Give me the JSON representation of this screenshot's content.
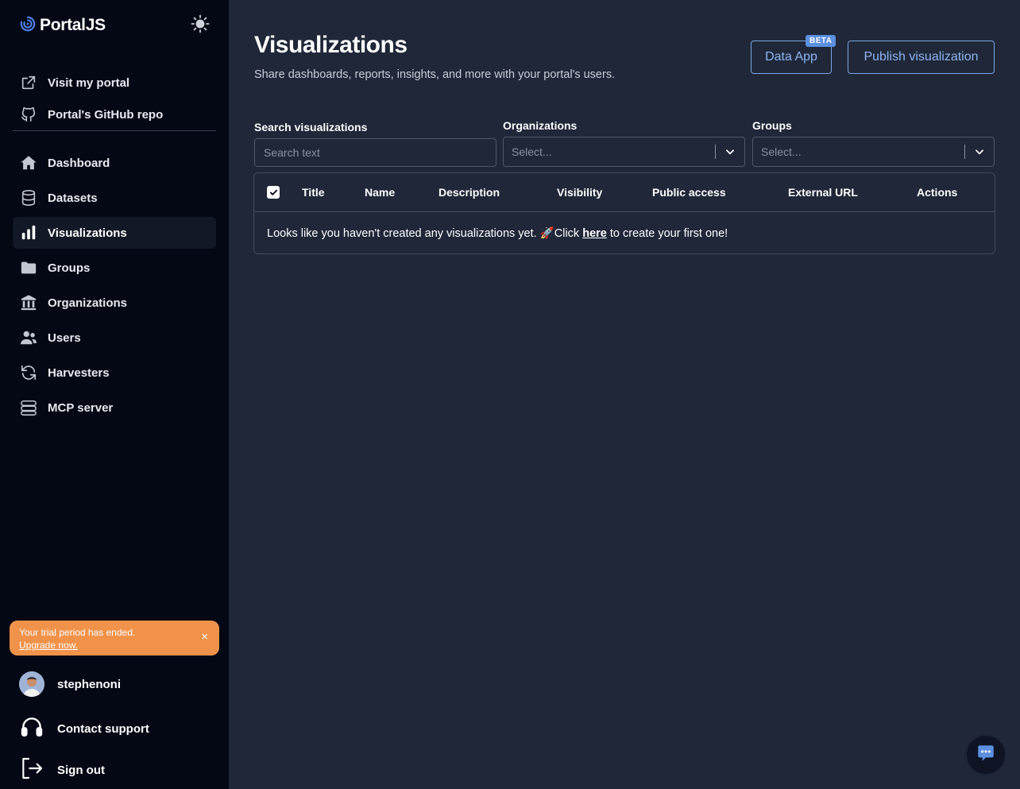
{
  "app": {
    "brand": "PortalJS"
  },
  "sidebar": {
    "top_links": [
      {
        "label": "Visit my portal",
        "icon": "external-link-icon"
      },
      {
        "label": "Portal's GitHub repo",
        "icon": "github-icon"
      }
    ],
    "nav": [
      {
        "label": "Dashboard",
        "icon": "home-icon"
      },
      {
        "label": "Datasets",
        "icon": "database-icon"
      },
      {
        "label": "Visualizations",
        "icon": "bar-chart-icon",
        "active": true
      },
      {
        "label": "Groups",
        "icon": "folder-icon"
      },
      {
        "label": "Organizations",
        "icon": "building-icon"
      },
      {
        "label": "Users",
        "icon": "users-icon"
      },
      {
        "label": "Harvesters",
        "icon": "refresh-icon"
      },
      {
        "label": "MCP server",
        "icon": "server-icon"
      }
    ],
    "trial": {
      "message": "Your trial period has ended.",
      "link": "Upgrade now.",
      "close": "×"
    },
    "user": {
      "name": "stephenoni"
    },
    "contact": "Contact support",
    "signout": "Sign out"
  },
  "main": {
    "title": "Visualizations",
    "subtitle": "Share dashboards, reports, insights, and more with your portal's users.",
    "data_app_button": "Data App",
    "beta_badge": "BETA",
    "publish_button": "Publish visualization",
    "filters": {
      "search_label": "Search visualizations",
      "search_placeholder": "Search text",
      "org_label": "Organizations",
      "org_placeholder": "Select...",
      "groups_label": "Groups",
      "groups_placeholder": "Select..."
    },
    "table": {
      "columns": [
        "Title",
        "Name",
        "Description",
        "Visibility",
        "Public access",
        "External URL",
        "Actions"
      ],
      "empty_before": "Looks like you haven't created any visualizations yet. 🚀Click ",
      "empty_link": "here",
      "empty_after": " to create your first one!"
    }
  },
  "colors": {
    "sidebar_bg": "#040714",
    "main_bg": "#1f2738",
    "accent": "#8db6f5",
    "trial_bg": "#f0924a",
    "brand_icon": "#4f7fe6"
  }
}
